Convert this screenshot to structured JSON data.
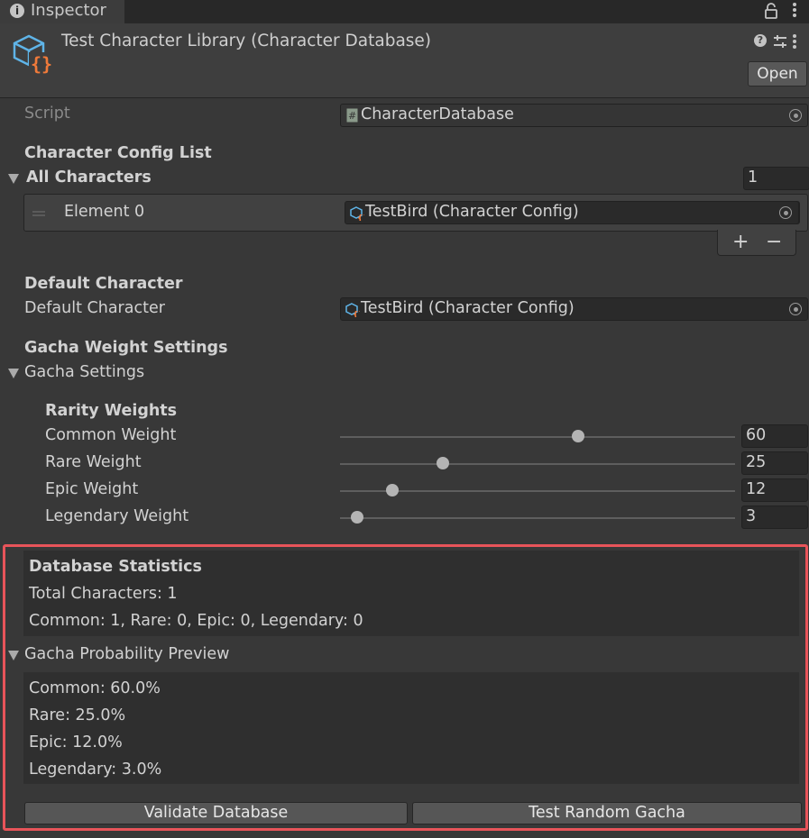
{
  "tab": {
    "title": "Inspector"
  },
  "header": {
    "asset_title": "Test Character Library (Character Database)",
    "open_label": "Open"
  },
  "script_field": {
    "label": "Script",
    "value": "CharacterDatabase"
  },
  "character_config": {
    "section_header": "Character Config List",
    "list_label": "All Characters",
    "count": "1",
    "elements": [
      {
        "label": "Element 0",
        "value": "TestBird (Character Config)"
      }
    ]
  },
  "default_character": {
    "section_header": "Default Character",
    "label": "Default Character",
    "value": "TestBird (Character Config)"
  },
  "gacha": {
    "section_header": "Gacha Weight Settings",
    "foldout_label": "Gacha Settings",
    "rarity_header": "Rarity Weights",
    "slider_max": 100,
    "weights": [
      {
        "label": "Common Weight",
        "value": "60",
        "fraction": 0.6
      },
      {
        "label": "Rare Weight",
        "value": "25",
        "fraction": 0.25
      },
      {
        "label": "Epic Weight",
        "value": "12",
        "fraction": 0.12
      },
      {
        "label": "Legendary Weight",
        "value": "3",
        "fraction": 0.03
      }
    ]
  },
  "stats": {
    "header": "Database Statistics",
    "total": "Total Characters: 1",
    "breakdown": "Common: 1, Rare: 0, Epic: 0, Legendary: 0"
  },
  "preview": {
    "foldout_label": "Gacha Probability Preview",
    "lines": [
      "Common: 60.0%",
      "Rare: 25.0%",
      "Epic: 12.0%",
      "Legendary: 3.0%"
    ]
  },
  "buttons": {
    "validate": "Validate Database",
    "test_gacha": "Test Random Gacha"
  },
  "colors": {
    "highlight": "#e8545a",
    "background": "#383838"
  }
}
